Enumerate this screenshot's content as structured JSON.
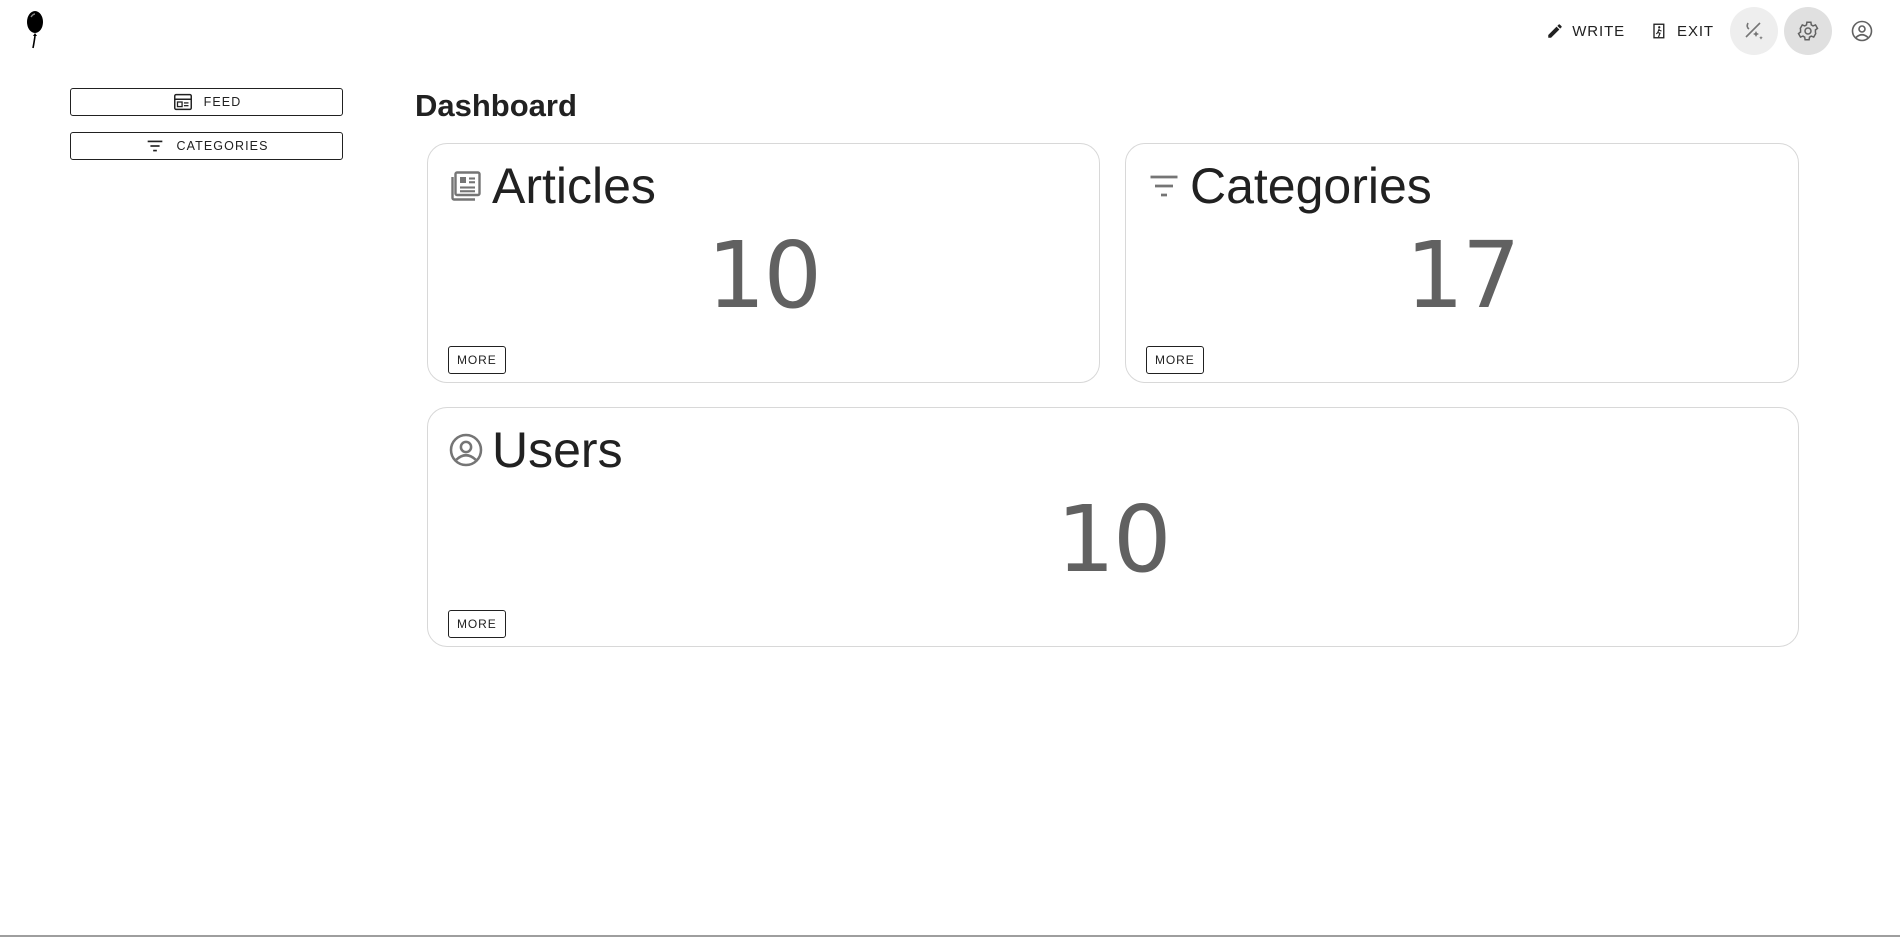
{
  "header": {
    "logo_icon": "balloon-icon",
    "write_label": "WRITE",
    "exit_label": "EXIT",
    "theme_icon": "theme-toggle-icon",
    "settings_icon": "gear-icon",
    "account_icon": "account-circle-icon"
  },
  "sidebar": {
    "items": [
      {
        "label": "FEED",
        "icon": "feed-icon"
      },
      {
        "label": "CATEGORIES",
        "icon": "filter-icon"
      }
    ]
  },
  "main": {
    "title": "Dashboard",
    "cards": [
      {
        "title": "Articles",
        "count": "10",
        "more": "MORE",
        "icon": "newspaper-icon"
      },
      {
        "title": "Categories",
        "count": "17",
        "more": "MORE",
        "icon": "filter-icon"
      },
      {
        "title": "Users",
        "count": "10",
        "more": "MORE",
        "icon": "account-circle-icon"
      }
    ]
  },
  "colors": {
    "text": "#212121",
    "count": "#616161",
    "card_border": "#d8d8d8",
    "icon": "#757575"
  }
}
